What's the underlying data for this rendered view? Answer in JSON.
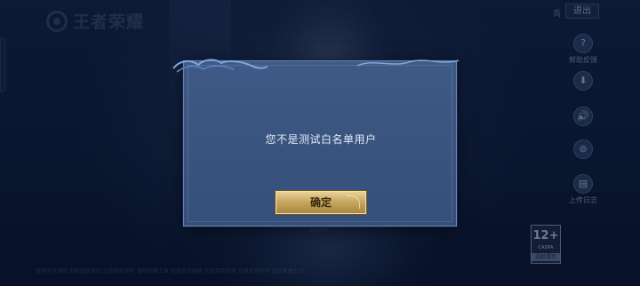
{
  "app": {
    "logo_text": "王者荣耀",
    "logo_icon": "game-logo-icon"
  },
  "top_right": {
    "label": "禹",
    "exit_label": "退出"
  },
  "side_menu": [
    {
      "icon": "?",
      "icon_name": "help-icon",
      "label": "帮助反馈"
    },
    {
      "icon": "⬇",
      "icon_name": "download-icon",
      "label": ""
    },
    {
      "icon": "🔊",
      "icon_name": "speaker-icon",
      "label": ""
    },
    {
      "icon": "⊚",
      "icon_name": "record-icon",
      "label": ""
    },
    {
      "icon": "▤",
      "icon_name": "log-icon",
      "label": "上传日志"
    }
  ],
  "rating": {
    "age": "12+",
    "sub": "CADPA",
    "tag": "适龄提示"
  },
  "start_hint": "START",
  "footer": "抵制不良游戏 拒绝盗版游戏 注意自我保护 谨防受骗上当 适度游戏益脑 沉迷游戏伤身 合理安排时间 享受健康生活",
  "dialog": {
    "message": "您不是测试白名单用户",
    "confirm_label": "确定"
  },
  "colors": {
    "dialog_bg": "#3a5580",
    "button_gold": "#c9a860",
    "background": "#0f1f3d"
  }
}
